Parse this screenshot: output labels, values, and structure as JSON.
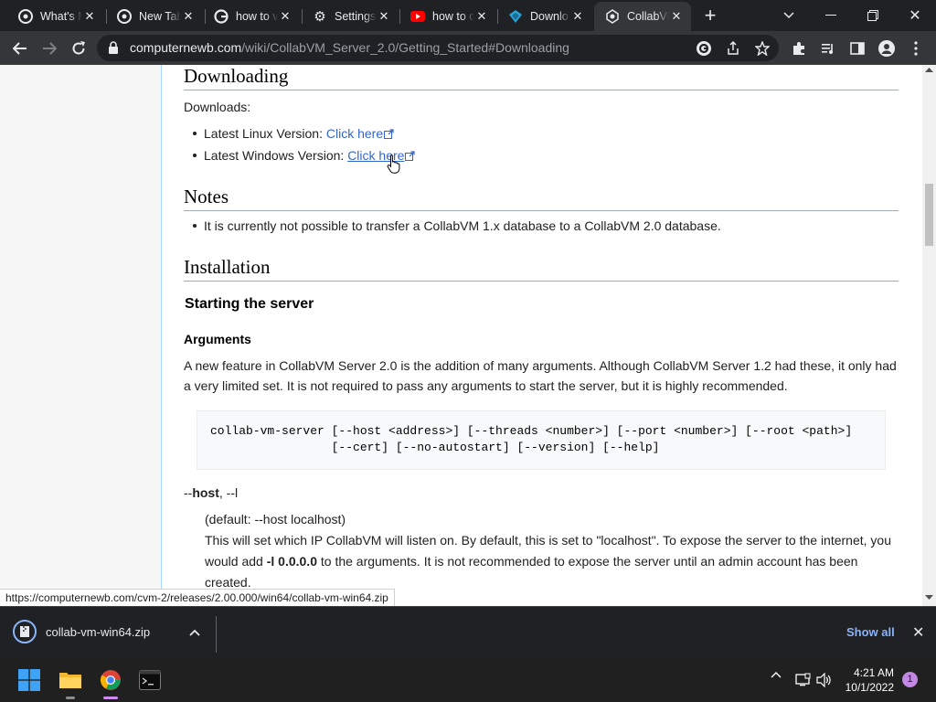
{
  "tabs": [
    {
      "title": "What's M",
      "icon": "chrome-icon"
    },
    {
      "title": "New Tab",
      "icon": "chrome-icon"
    },
    {
      "title": "how to v",
      "icon": "google-icon"
    },
    {
      "title": "Settings",
      "icon": "gear-icon"
    },
    {
      "title": "how to c",
      "icon": "youtube-icon"
    },
    {
      "title": "Downlo",
      "icon": "vm-icon"
    },
    {
      "title": "CollabVM",
      "icon": "collabvm-icon",
      "active": true
    }
  ],
  "address_bar": {
    "host": "computernewb.com",
    "path": "/wiki/CollabVM_Server_2.0/Getting_Started#Downloading"
  },
  "page": {
    "downloading_heading": "Downloading",
    "downloads_label": "Downloads:",
    "linux_label": "Latest Linux Version:",
    "linux_link": "Click here",
    "windows_label": "Latest Windows Version:",
    "windows_link": "Click here",
    "notes_heading": "Notes",
    "note_1": "It is currently not possible to transfer a CollabVM 1.x database to a CollabVM 2.0 database.",
    "installation_heading": "Installation",
    "starting_heading": "Starting the server",
    "arguments_heading": "Arguments",
    "arguments_para_line1": "A new feature in CollabVM Server 2.0 is the addition of many arguments. Although CollabVM Server 1.2 had these, it only had",
    "arguments_para_line2": "a very limited set. It is not required to pass any arguments to start the server, but it is highly recommended.",
    "code_line1": "collab-vm-server [--host <address>] [--threads <number>] [--port <number>] [--root <path>]",
    "code_line2": "                 [--cert] [--no-autostart] [--version] [--help]",
    "host_arg_prefix": "--",
    "host_arg_bold": "host",
    "host_arg_suffix": ", --l",
    "host_default": "(default: --host localhost)",
    "host_desc_line1": "This will set which IP CollabVM will listen on. By default, this is set to \"localhost\". To expose the server to the internet, you",
    "host_desc_line2_pre": "would add ",
    "host_desc_line2_bold": "-l 0.0.0.0",
    "host_desc_line2_post": " to the arguments. It is not recommended to expose the server until an admin account has been",
    "host_desc_line3": "created."
  },
  "status_url": "https://computernewb.com/cvm-2/releases/2.00.000/win64/collab-vm-win64.zip",
  "download_shelf": {
    "file_name": "collab-vm-win64.zip",
    "show_all": "Show all"
  },
  "taskbar": {
    "time": "4:21 AM",
    "date": "10/1/2022",
    "notification_count": "1"
  }
}
